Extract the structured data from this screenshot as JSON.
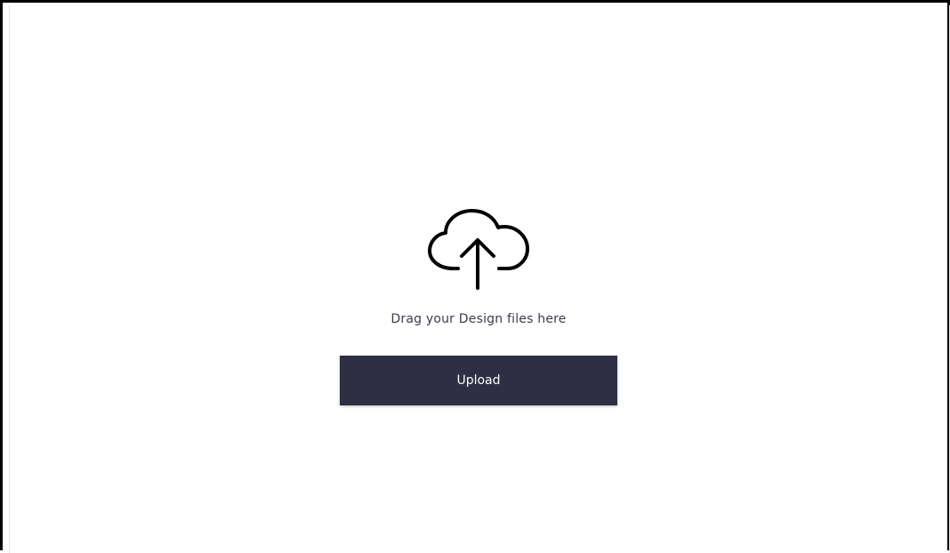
{
  "colors": {
    "button_background": "#2e2f42",
    "button_text": "#ffffff",
    "text": "#3a3c4c",
    "icon_stroke": "#000000",
    "frame_border": "#000000"
  },
  "dropzone": {
    "icon": "cloud-upload-icon",
    "instruction": "Drag your Design files here",
    "upload_label": "Upload"
  }
}
